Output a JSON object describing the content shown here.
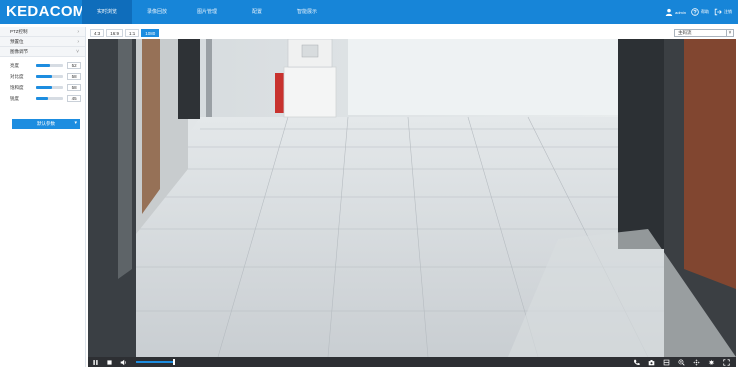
{
  "header": {
    "logo": "KEDACOM",
    "nav": [
      "实时浏览",
      "录像回放",
      "图片管理",
      "配置",
      "智能展示"
    ],
    "active_index": 0,
    "user": "admin",
    "help": "帮助",
    "logout": "注销"
  },
  "sidebar": {
    "sections": [
      {
        "label": "PTZ控制",
        "expanded": false
      },
      {
        "label": "预置位",
        "expanded": false
      },
      {
        "label": "图像调节",
        "expanded": true
      }
    ],
    "sliders": [
      {
        "label": "亮度",
        "value": "52",
        "level": 52
      },
      {
        "label": "对比度",
        "value": "58",
        "level": 58
      },
      {
        "label": "饱和度",
        "value": "58",
        "level": 58
      },
      {
        "label": "锐度",
        "value": "45",
        "level": 45
      }
    ],
    "default_button": "默认参数"
  },
  "toolbar": {
    "ratios": [
      "4:3",
      "16:9",
      "1:1",
      "1080"
    ],
    "active_ratio": 3,
    "stream": "主码流"
  },
  "controls": {
    "volume_level": 0.85
  },
  "colors": {
    "accent": "#1785d8",
    "control_bar": "#2d2f33"
  }
}
